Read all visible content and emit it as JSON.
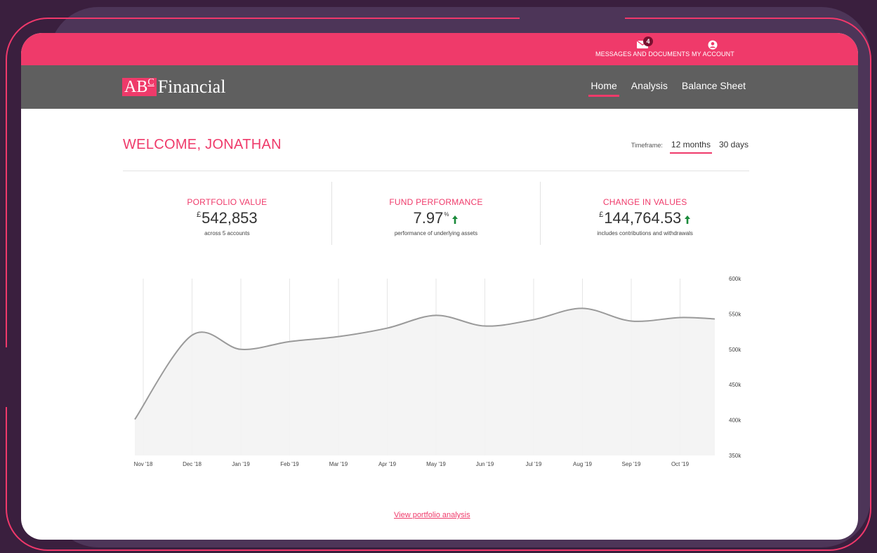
{
  "topbar": {
    "messages": {
      "label": "MESSAGES AND DOCUMENTS",
      "badge": "4",
      "icon": "envelope-icon"
    },
    "account": {
      "label": "MY ACCOUNT",
      "icon": "user-circle-icon"
    }
  },
  "brand": {
    "logo_mark": "AB",
    "logo_sup": "C",
    "logo_text": "Financial"
  },
  "nav": {
    "items": [
      {
        "label": "Home",
        "active": true
      },
      {
        "label": "Analysis",
        "active": false
      },
      {
        "label": "Balance Sheet",
        "active": false
      }
    ]
  },
  "welcome": "WELCOME, JONATHAN",
  "timeframe": {
    "label": "Timeframe:",
    "options": [
      "12 months",
      "30 days"
    ],
    "selected": "12 months"
  },
  "stats": [
    {
      "label": "PORTFOLIO VALUE",
      "currency": "£",
      "value": "542,853",
      "suffix": "",
      "trend": "",
      "sub": "across 5 accounts"
    },
    {
      "label": "FUND PERFORMANCE",
      "currency": "",
      "value": "7.97",
      "suffix": "%",
      "trend": "up",
      "sub": "performance of underlying assets"
    },
    {
      "label": "CHANGE IN VALUES",
      "currency": "£",
      "value": "144,764.53",
      "suffix": "",
      "trend": "up",
      "sub": "includes contributions and withdrawals"
    }
  ],
  "colors": {
    "accent": "#ef3a6a",
    "nav_bg": "#5f5f5f",
    "trend_up": "#1a8a3a",
    "line": "#9a9a9a",
    "area": "#f3f3f3"
  },
  "chart_data": {
    "type": "area",
    "x": [
      "Nov '18",
      "Dec '18",
      "Jan '19",
      "Feb '19",
      "Mar '19",
      "Apr '19",
      "May '19",
      "Jun '19",
      "Jul '19",
      "Aug '19",
      "Sep '19",
      "Oct '19"
    ],
    "series": [
      {
        "values": [
          401,
          520,
          500,
          511,
          518,
          530,
          548,
          533,
          542,
          558,
          540,
          545,
          543
        ]
      }
    ],
    "ylim": [
      350,
      600
    ],
    "yticks": [
      "350k",
      "400k",
      "450k",
      "500k",
      "550k",
      "600k"
    ],
    "grid": true
  },
  "link": "View portfolio analysis"
}
